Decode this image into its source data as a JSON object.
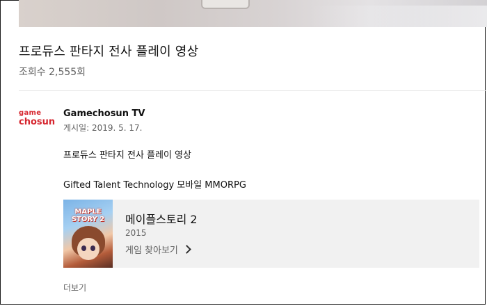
{
  "video": {
    "title": "프로듀스 판타지 전사 플레이 영상",
    "views": "조회수 2,555회"
  },
  "channel": {
    "logo_line1": "game",
    "logo_line2": "chosun",
    "name": "Gamechosun TV",
    "published": "게시일: 2019. 5. 17."
  },
  "description": {
    "line1": "프로듀스 판타지 전사 플레이 영상",
    "line2": "Gifted Talent Technology 모바일 MMORPG"
  },
  "game": {
    "art_text": "MAPLE STORY 2",
    "title": "메이플스토리 2",
    "year": "2015",
    "browse_label": "게임 찾아보기"
  },
  "more_label": "더보기",
  "colors": {
    "logo_red": "#d6262f",
    "secondary_text": "#606060",
    "card_bg": "#f1f1f1"
  }
}
